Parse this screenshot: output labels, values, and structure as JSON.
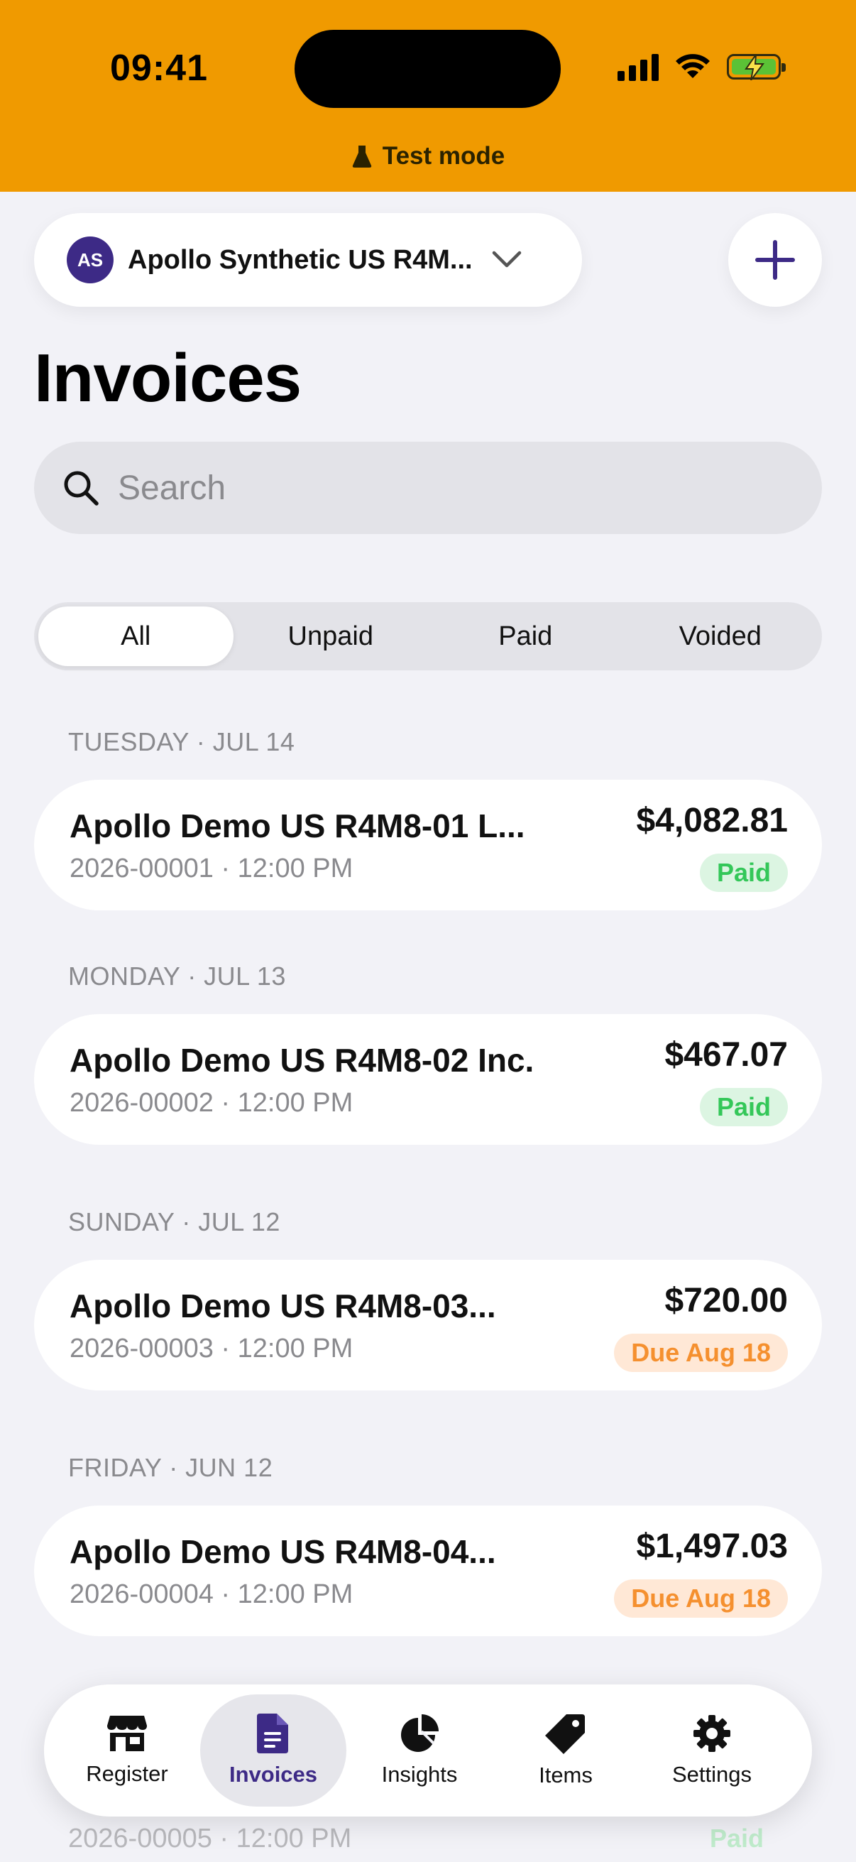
{
  "status_bar": {
    "time": "09:41"
  },
  "banner": {
    "label": "Test mode",
    "icon": "flask-icon",
    "color": "#F09A00"
  },
  "account": {
    "initials": "AS",
    "name": "Apollo Synthetic US R4M...",
    "avatar_color": "#3D2A86"
  },
  "page": {
    "title": "Invoices"
  },
  "search": {
    "placeholder": "Search",
    "value": ""
  },
  "filters": [
    {
      "label": "All",
      "active": true
    },
    {
      "label": "Unpaid",
      "active": false
    },
    {
      "label": "Paid",
      "active": false
    },
    {
      "label": "Voided",
      "active": false
    }
  ],
  "groups": [
    {
      "label": "TUESDAY · JUL 14",
      "invoice": {
        "name": "Apollo Demo US R4M8-01 L...",
        "meta": "2026-00001 · 12:00 PM",
        "amount": "$4,082.81",
        "status": "Paid",
        "status_type": "paid"
      }
    },
    {
      "label": "MONDAY · JUL 13",
      "invoice": {
        "name": "Apollo Demo US R4M8-02 Inc.",
        "meta": "2026-00002 · 12:00 PM",
        "amount": "$467.07",
        "status": "Paid",
        "status_type": "paid"
      }
    },
    {
      "label": "SUNDAY · JUL 12",
      "invoice": {
        "name": "Apollo Demo US R4M8-03...",
        "meta": "2026-00003 · 12:00 PM",
        "amount": "$720.00",
        "status": "Due Aug 18",
        "status_type": "due"
      }
    },
    {
      "label": "FRIDAY · JUN 12",
      "invoice": {
        "name": "Apollo Demo US R4M8-04...",
        "meta": "2026-00004 · 12:00 PM",
        "amount": "$1,497.03",
        "status": "Due Aug 18",
        "status_type": "due"
      }
    }
  ],
  "peek_row": {
    "meta": "2026-00005 · 12:00 PM",
    "status": "Paid"
  },
  "tabs": [
    {
      "label": "Register",
      "icon": "store-icon",
      "active": false
    },
    {
      "label": "Invoices",
      "icon": "document-icon",
      "active": true
    },
    {
      "label": "Insights",
      "icon": "pie-chart-icon",
      "active": false
    },
    {
      "label": "Items",
      "icon": "tag-icon",
      "active": false
    },
    {
      "label": "Settings",
      "icon": "gear-icon",
      "active": false
    }
  ],
  "colors": {
    "accent": "#3D2A86",
    "paid": "#34C759",
    "due": "#F5902F"
  }
}
